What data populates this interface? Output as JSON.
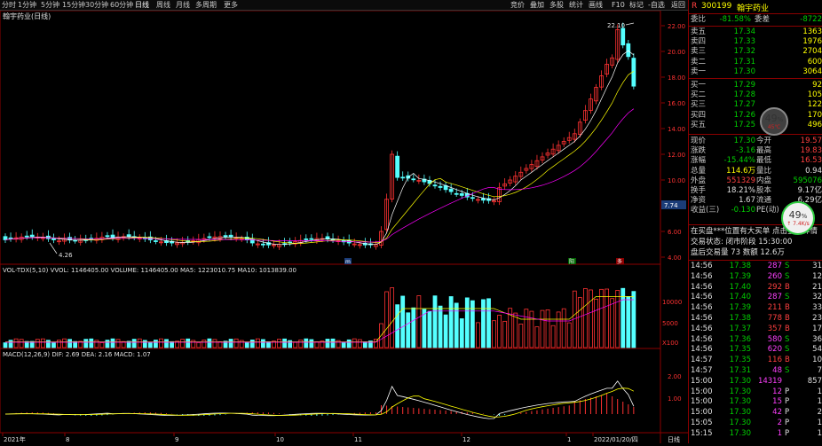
{
  "toolbar": {
    "left": [
      "分时",
      "1分钟",
      "5分钟",
      "15分钟",
      "30分钟",
      "60分钟",
      "日线",
      "周线",
      "月线",
      "多周期",
      "更多"
    ],
    "right": [
      "竞价",
      "叠加",
      "多股",
      "统计",
      "画线",
      "F10",
      "标记",
      "-自选",
      "返回"
    ],
    "active_index": 6
  },
  "chart": {
    "stock_title": "翰宇药业(日线)",
    "price_axis": [
      "22.00",
      "20.00",
      "18.00",
      "16.00",
      "14.00",
      "12.00",
      "10.00",
      "8.00",
      "6.00",
      "4.00"
    ],
    "high_label": "22.10",
    "low_label": "4.26",
    "price_tag": "7.74",
    "volume_header": "VOL-TDX(5,10) VVOL: 1146405.00  VOLUME: 1146405.00  MA5: 1223010.75  MA10: 1013839.00",
    "volume_axis": [
      "10000",
      "5000",
      "X100"
    ],
    "macd_header": "MACD(12,26,9)  DIF: 2.69  DEA: 2.16  MACD: 1.07",
    "macd_axis": [
      "2.00",
      "1.00"
    ],
    "date_axis": [
      "2021年",
      "8",
      "9",
      "10",
      "11",
      "12",
      "1",
      "2022/01/20/四"
    ],
    "period_label": "日线",
    "markers": {
      "a": "m",
      "b": "阳",
      "c": "多"
    }
  },
  "quote": {
    "code": "300199",
    "name": "翰宇药业",
    "r_label": "R",
    "weibi_label": "委比",
    "weibi": "-81.58%",
    "weicha_label": "委差",
    "weicha": "-8722",
    "sells": [
      {
        "label": "卖五",
        "price": "17.34",
        "vol": "1363"
      },
      {
        "label": "卖四",
        "price": "17.33",
        "vol": "1976"
      },
      {
        "label": "卖三",
        "price": "17.32",
        "vol": "2704"
      },
      {
        "label": "卖二",
        "price": "17.31",
        "vol": "600"
      },
      {
        "label": "卖一",
        "price": "17.30",
        "vol": "3064"
      }
    ],
    "buys": [
      {
        "label": "买一",
        "price": "17.29",
        "vol": "92"
      },
      {
        "label": "买二",
        "price": "17.28",
        "vol": "105"
      },
      {
        "label": "买三",
        "price": "17.27",
        "vol": "122"
      },
      {
        "label": "买四",
        "price": "17.26",
        "vol": "170"
      },
      {
        "label": "买五",
        "price": "17.25",
        "vol": "496"
      }
    ],
    "stats": [
      {
        "l1": "现价",
        "v1": "17.30",
        "l2": "今开",
        "v2": "19.57"
      },
      {
        "l1": "涨跌",
        "v1": "-3.16",
        "l2": "最高",
        "v2": "19.83"
      },
      {
        "l1": "涨幅",
        "v1": "-15.44%",
        "l2": "最低",
        "v2": "16.53"
      },
      {
        "l1": "总量",
        "v1": "114.6万",
        "l2": "量比",
        "v2": "0.94"
      },
      {
        "l1": "外盘",
        "v1": "551329",
        "l2": "内盘",
        "v2": "595076"
      },
      {
        "l1": "换手",
        "v1": "18.21%",
        "l2": "股本",
        "v2": "9.17亿"
      },
      {
        "l1": "净资",
        "v1": "1.67",
        "l2": "流通",
        "v2": "6.29亿"
      },
      {
        "l1": "收益(三)",
        "v1": "-0.130",
        "l2": "PE(动)",
        "v2": ""
      }
    ],
    "info_lines": [
      "在买盘***位置有大买单 点击查看详情",
      "交易状态: 闭市阶段 15:30:00",
      "盘后交易量 73  数额 12.6万"
    ],
    "ticks": [
      {
        "time": "14:56",
        "price": "17.38",
        "vol": "287",
        "dir": "S",
        "n": "31"
      },
      {
        "time": "14:56",
        "price": "17.39",
        "vol": "260",
        "dir": "S",
        "n": "12"
      },
      {
        "time": "14:56",
        "price": "17.40",
        "vol": "292",
        "dir": "B",
        "n": "21"
      },
      {
        "time": "14:56",
        "price": "17.40",
        "vol": "287",
        "dir": "S",
        "n": "32"
      },
      {
        "time": "14:56",
        "price": "17.39",
        "vol": "211",
        "dir": "B",
        "n": "33"
      },
      {
        "time": "14:56",
        "price": "17.38",
        "vol": "778",
        "dir": "B",
        "n": "23"
      },
      {
        "time": "14:56",
        "price": "17.37",
        "vol": "357",
        "dir": "B",
        "n": "17"
      },
      {
        "time": "14:56",
        "price": "17.36",
        "vol": "580",
        "dir": "S",
        "n": "36"
      },
      {
        "time": "14:56",
        "price": "17.35",
        "vol": "620",
        "dir": "S",
        "n": "54"
      },
      {
        "time": "14:57",
        "price": "17.35",
        "vol": "116",
        "dir": "B",
        "n": "10"
      },
      {
        "time": "14:57",
        "price": "17.31",
        "vol": "48",
        "dir": "S",
        "n": "7"
      },
      {
        "time": "15:00",
        "price": "17.30",
        "vol": "14319",
        "dir": "",
        "n": "857"
      },
      {
        "time": "15:00",
        "price": "17.30",
        "vol": "12",
        "dir": "P",
        "n": "1"
      },
      {
        "time": "15:00",
        "price": "17.30",
        "vol": "15",
        "dir": "P",
        "n": "1"
      },
      {
        "time": "15:00",
        "price": "17.30",
        "vol": "42",
        "dir": "P",
        "n": "2"
      },
      {
        "time": "15:05",
        "price": "17.30",
        "vol": "2",
        "dir": "P",
        "n": "1"
      },
      {
        "time": "15:15",
        "price": "17.30",
        "vol": "1",
        "dir": "P",
        "n": "1"
      }
    ],
    "badge1": {
      "pct": "49",
      "unit": "%",
      "sub": "45℃",
      "sub2": "CPU温度"
    },
    "badge2": {
      "pct": "49",
      "unit": "%",
      "sub": "↑ 7.4K/s"
    }
  },
  "colors": {
    "up": "#ff3232",
    "down": "#54ffff",
    "ma_white": "#ffffff",
    "ma_yellow": "#ffff00",
    "ma_magenta": "#ff00ff",
    "grid": "#8b0000"
  }
}
